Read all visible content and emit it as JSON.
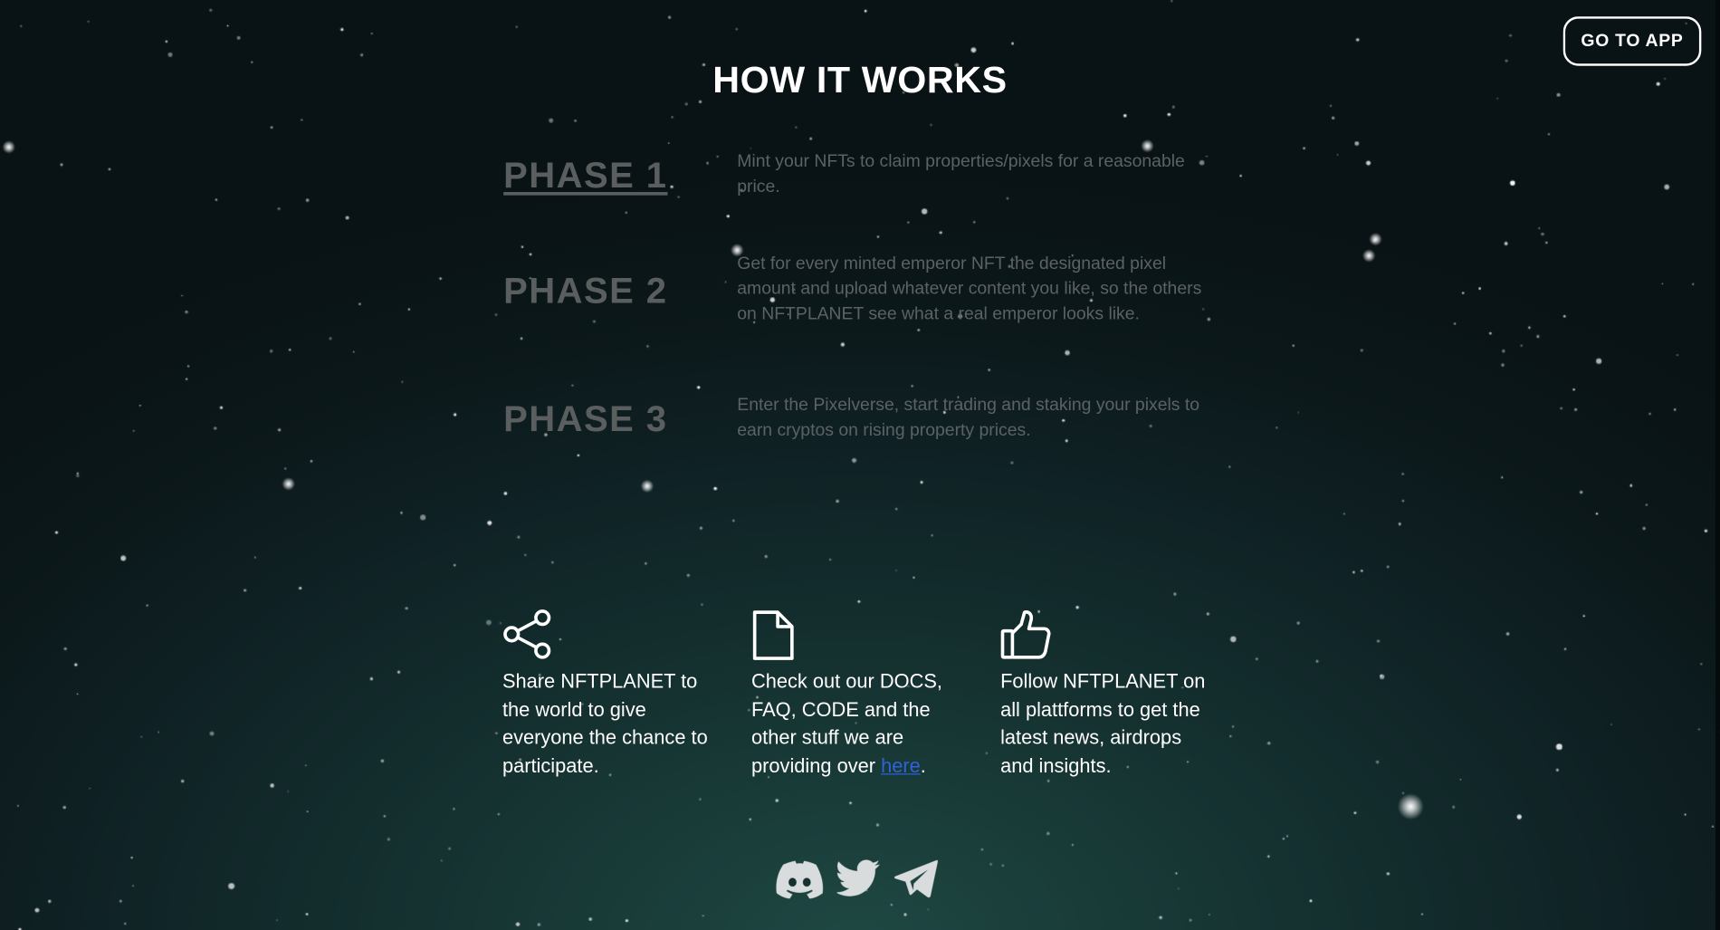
{
  "header": {
    "title": "HOW IT WORKS",
    "go_to_app_label": "GO TO APP"
  },
  "phases": [
    {
      "name": "PHASE 1",
      "description": "Mint your NFTs  to claim properties/pixels for a reasonable price."
    },
    {
      "name": "PHASE 2",
      "description": "Get for every minted emperor NFT the designated pixel amount and upload whatever content you like, so the others on NFTPLANET see what a real emperor looks like."
    },
    {
      "name": "PHASE 3",
      "description": "Enter the Pixelverse, start trading and staking your pixels to earn cryptos on rising property prices."
    }
  ],
  "features": [
    {
      "icon": "share-icon",
      "text": "Share NFTPLANET to the world to give everyone the chance to participate."
    },
    {
      "icon": "document-icon",
      "text_before": "Check out our DOCS, FAQ, CODE and the other stuff we are providing over ",
      "link_label": "here",
      "text_after": "."
    },
    {
      "icon": "thumbs-up-icon",
      "text": "Follow NFTPLANET on all plattforms to get the latest news, airdrops and insights."
    }
  ],
  "social": [
    {
      "icon": "discord-icon"
    },
    {
      "icon": "twitter-icon"
    },
    {
      "icon": "telegram-icon"
    }
  ],
  "colors": {
    "background": "#0b1517",
    "title": "#ffffff",
    "phase_name": "#5b5e5f",
    "phase_text": "#5c6264",
    "link": "#2f63d6"
  }
}
